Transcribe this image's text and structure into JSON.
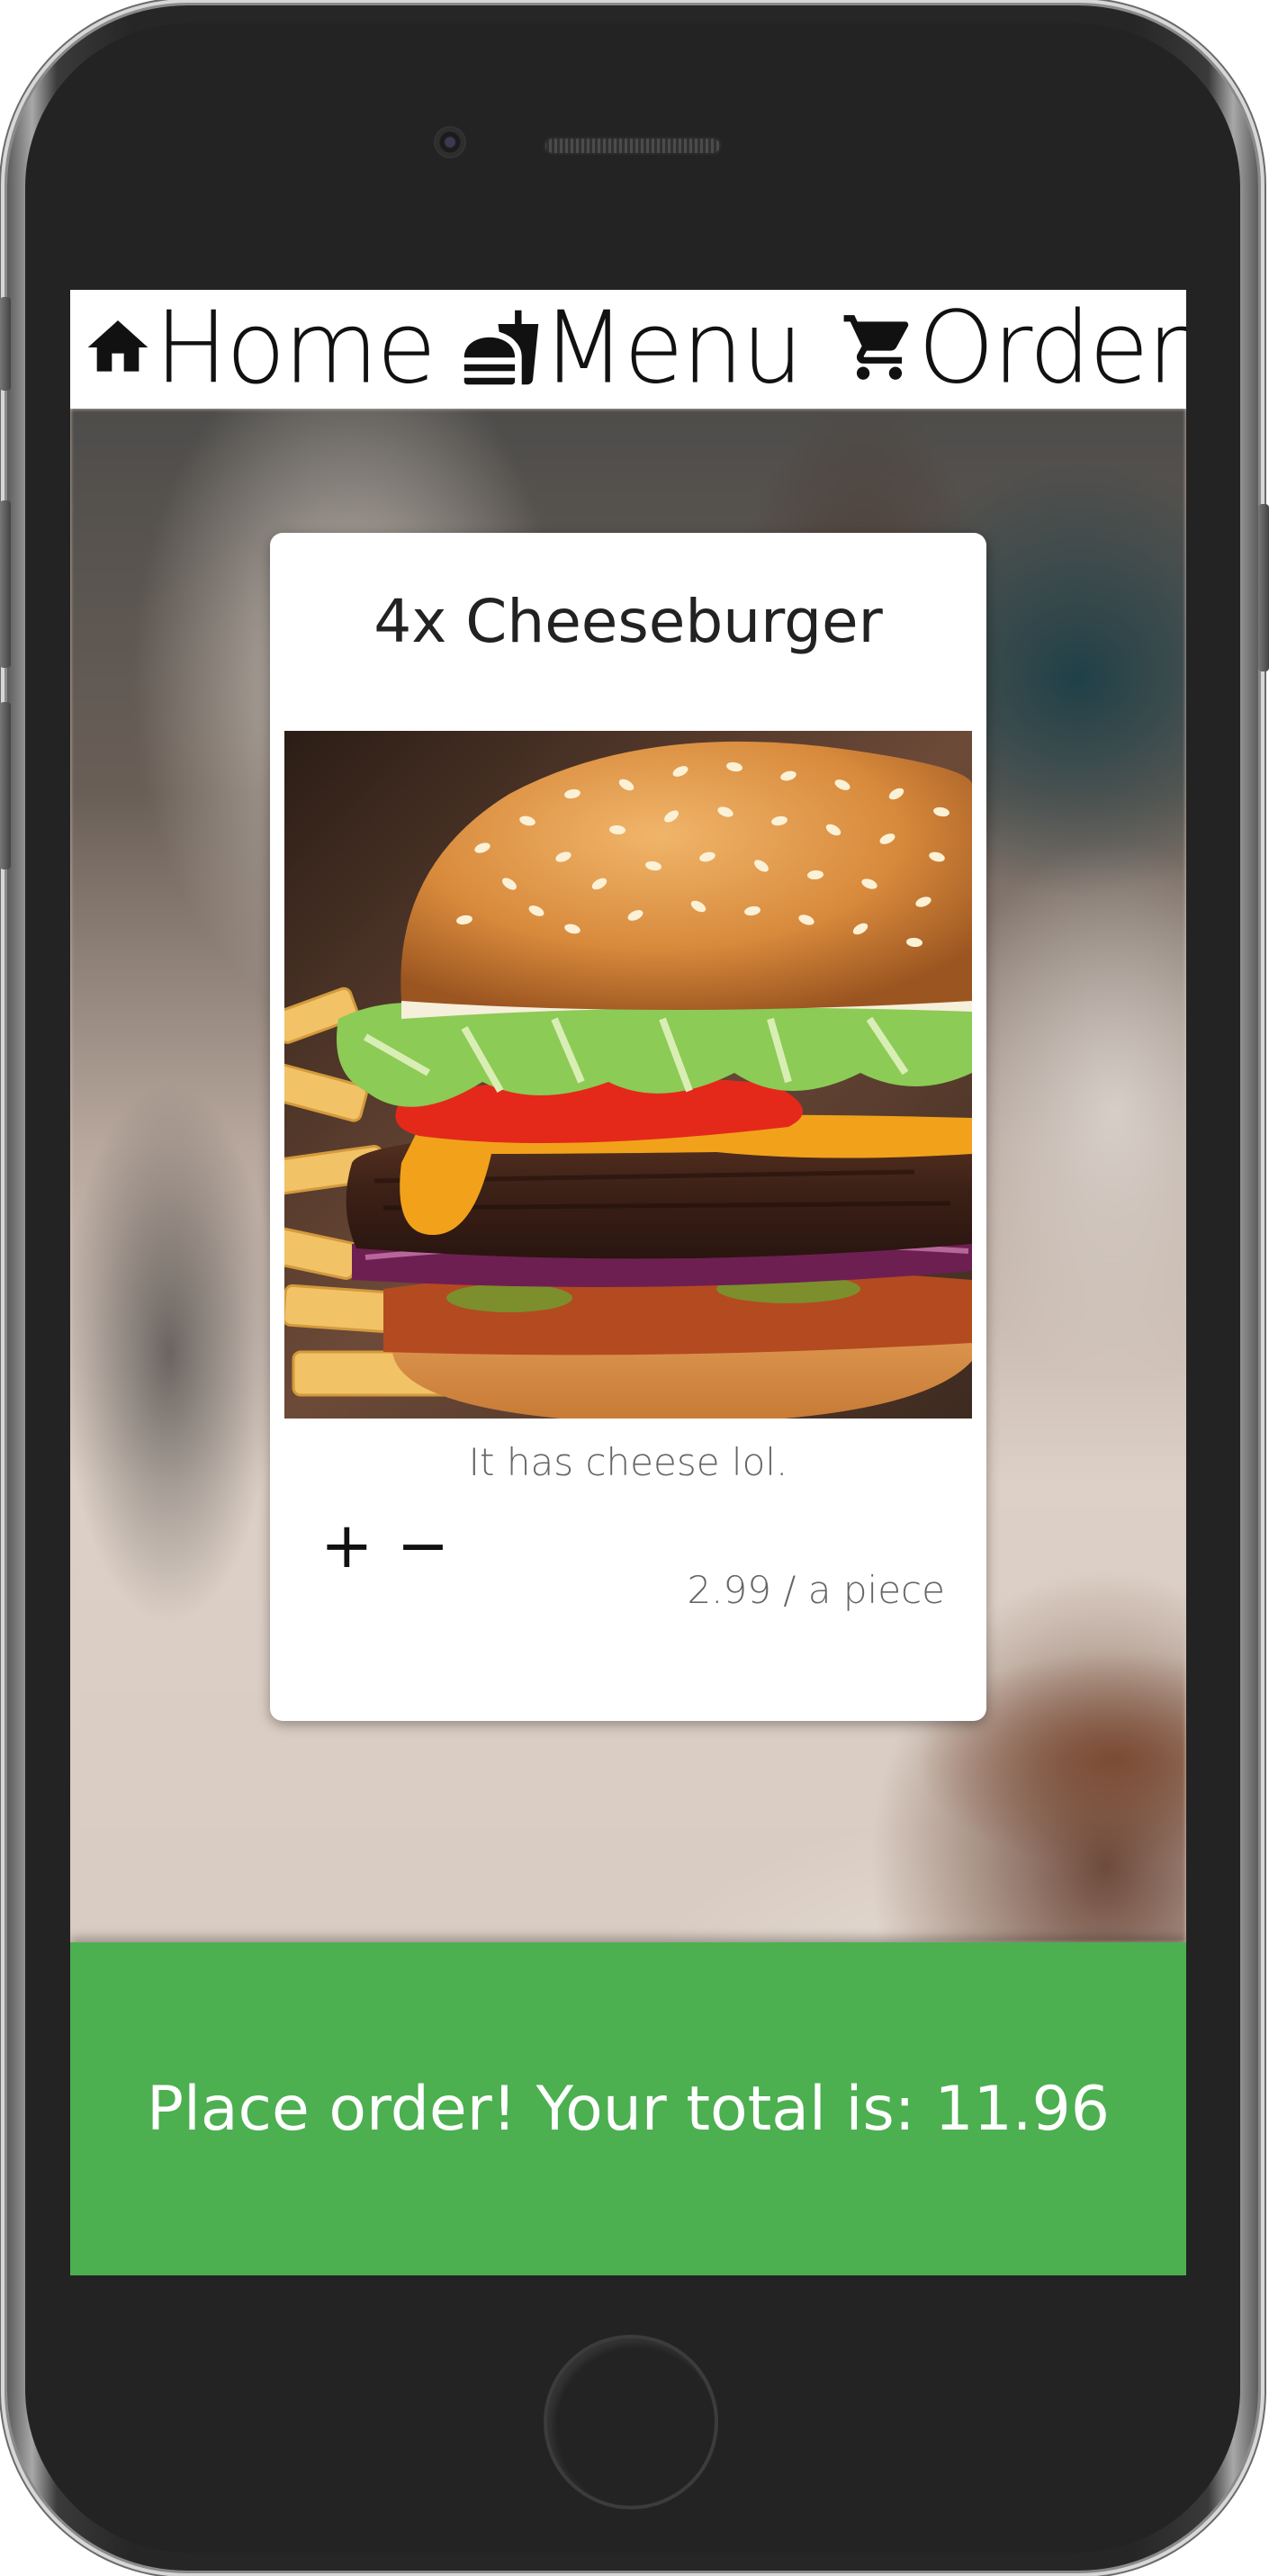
{
  "nav": {
    "home_label": "Home",
    "home_icon": "home-icon",
    "menu_label": "Menu",
    "menu_icon": "fastfood-icon",
    "order_label": "Order",
    "order_icon": "shopping-cart-icon"
  },
  "product": {
    "title": "4x Cheeseburger",
    "image": "cheeseburger-photo",
    "description": "It has cheese lol.",
    "price": "2.99 / a piece",
    "increment_label": "+",
    "decrement_label": "−"
  },
  "order": {
    "button_text": "Place order! Your total is: 11.96",
    "button_color": "#4caf50"
  }
}
